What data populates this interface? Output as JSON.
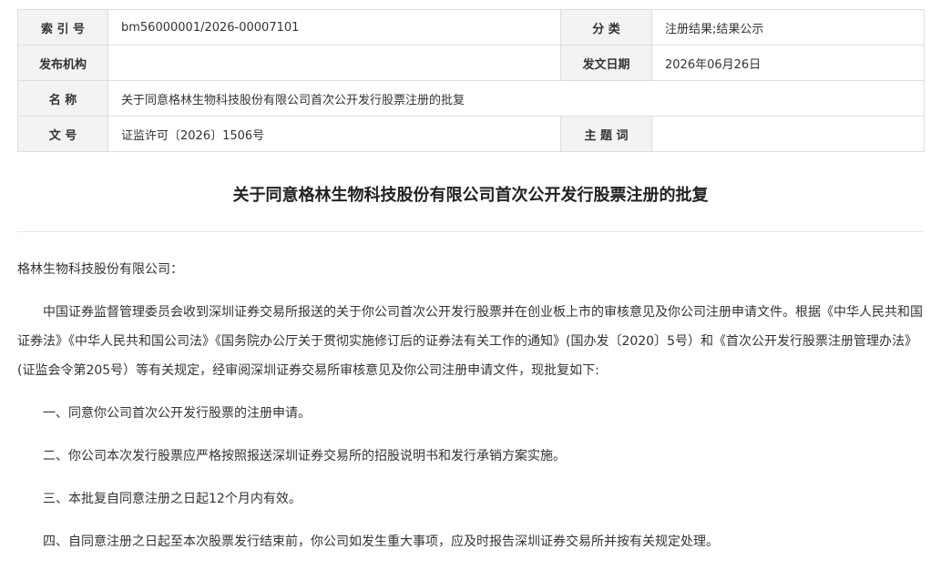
{
  "meta": {
    "rows": [
      [
        {
          "label": "索 引 号",
          "value": "bm56000001/2026-00007101"
        },
        {
          "label": "分 类",
          "value": "注册结果;结果公示"
        }
      ],
      [
        {
          "label": "发布机构",
          "value": ""
        },
        {
          "label": "发文日期",
          "value": "2026年06月26日"
        }
      ],
      [
        {
          "label": "名 称",
          "value": "关于同意格林生物科技股份有限公司首次公开发行股票注册的批复"
        }
      ],
      [
        {
          "label": "文 号",
          "value": "证监许可〔2026〕1506号"
        },
        {
          "label": "主 题 词",
          "value": ""
        }
      ]
    ]
  },
  "title": "关于同意格林生物科技股份有限公司首次公开发行股票注册的批复",
  "body": {
    "salutation": "格林生物科技股份有限公司：",
    "intro": "中国证券监督管理委员会收到深圳证券交易所报送的关于你公司首次公开发行股票并在创业板上市的审核意见及你公司注册申请文件。根据《中华人民共和国证券法》《中华人民共和国公司法》《国务院办公厅关于贯彻实施修订后的证券法有关工作的通知》(国办发〔2020〕5号）和《首次公开发行股票注册管理办法》(证监会令第205号）等有关规定，经审阅深圳证券交易所审核意见及你公司注册申请文件，现批复如下:",
    "items": [
      "一、同意你公司首次公开发行股票的注册申请。",
      "二、你公司本次发行股票应严格按照报送深圳证券交易所的招股说明书和发行承销方案实施。",
      "三、本批复自同意注册之日起12个月内有效。",
      "四、自同意注册之日起至本次股票发行结束前，你公司如发生重大事项，应及时报告深圳证券交易所并按有关规定处理。"
    ]
  }
}
